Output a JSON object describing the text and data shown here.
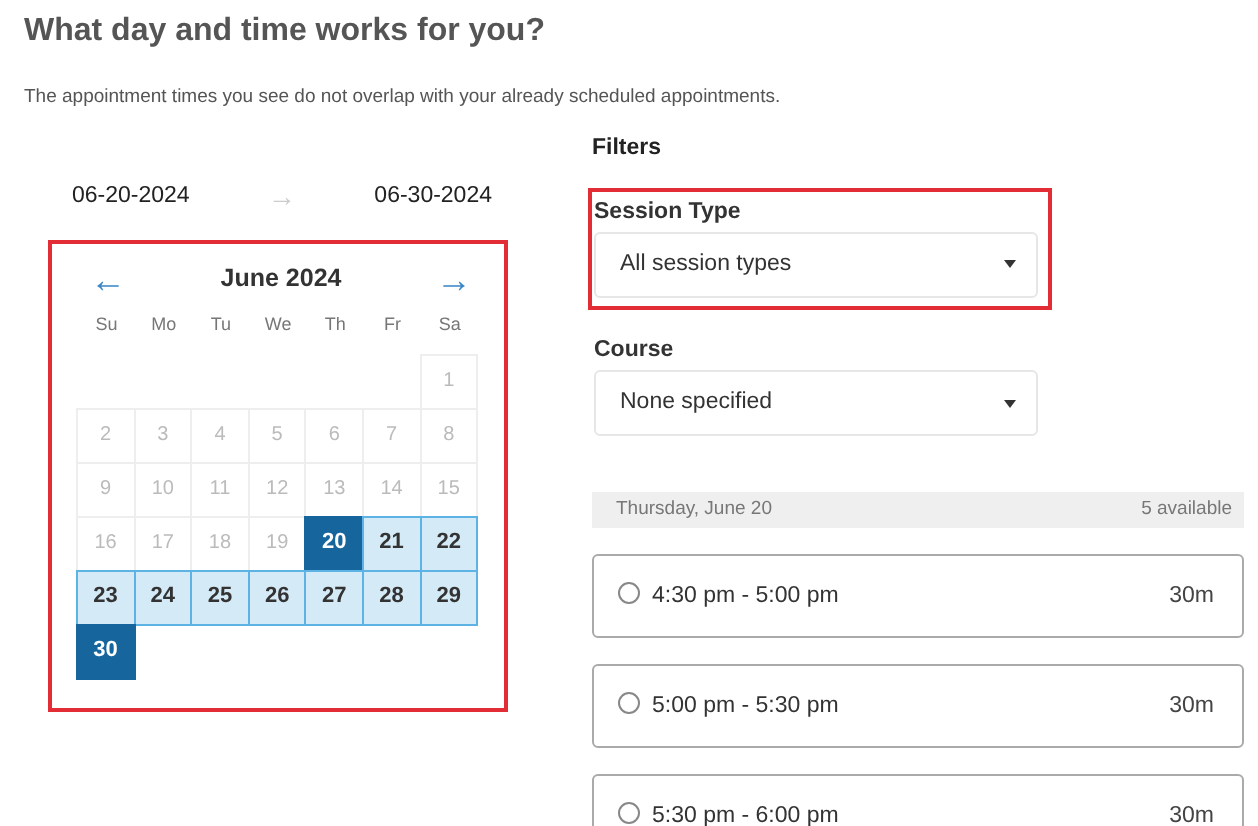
{
  "heading": "What day and time works for you?",
  "subtitle": "The appointment times you see do not overlap with your already scheduled appointments.",
  "date_range": {
    "start": "06-20-2024",
    "arrow": "→",
    "end": "06-30-2024"
  },
  "calendar": {
    "highlighted": true,
    "prev": "←",
    "month": "June 2024",
    "next": "→",
    "weekdays": [
      "Su",
      "Mo",
      "Tu",
      "We",
      "Th",
      "Fr",
      "Sa"
    ],
    "weeks": [
      [
        {
          "day": "1",
          "disabled": true,
          "selected": false
        }
      ],
      [
        {
          "day": "2",
          "disabled": true,
          "selected": false
        },
        {
          "day": "3",
          "disabled": true,
          "selected": false
        },
        {
          "day": "4",
          "disabled": true,
          "selected": false
        },
        {
          "day": "5",
          "disabled": true,
          "selected": false
        },
        {
          "day": "6",
          "disabled": true,
          "selected": false
        },
        {
          "day": "7",
          "disabled": true,
          "selected": false
        },
        {
          "day": "8",
          "disabled": true,
          "selected": false
        }
      ],
      [
        {
          "day": "9",
          "disabled": true,
          "selected": false
        },
        {
          "day": "10",
          "disabled": true,
          "selected": false
        },
        {
          "day": "11",
          "disabled": true,
          "selected": false
        },
        {
          "day": "12",
          "disabled": true,
          "selected": false
        },
        {
          "day": "13",
          "disabled": true,
          "selected": false
        },
        {
          "day": "14",
          "disabled": true,
          "selected": false
        },
        {
          "day": "15",
          "disabled": true,
          "selected": false
        }
      ],
      [
        {
          "day": "16",
          "disabled": true,
          "selected": false
        },
        {
          "day": "17",
          "disabled": true,
          "selected": false
        },
        {
          "day": "18",
          "disabled": true,
          "selected": false
        },
        {
          "day": "19",
          "disabled": true,
          "selected": false
        },
        {
          "day": "20",
          "disabled": false,
          "selected": true
        },
        {
          "day": "21",
          "disabled": false,
          "selected": false
        },
        {
          "day": "22",
          "disabled": false,
          "selected": false
        }
      ],
      [
        {
          "day": "23",
          "disabled": false,
          "selected": false
        },
        {
          "day": "24",
          "disabled": false,
          "selected": false
        },
        {
          "day": "25",
          "disabled": false,
          "selected": false
        },
        {
          "day": "26",
          "disabled": false,
          "selected": false
        },
        {
          "day": "27",
          "disabled": false,
          "selected": false
        },
        {
          "day": "28",
          "disabled": false,
          "selected": false
        },
        {
          "day": "29",
          "disabled": false,
          "selected": false
        }
      ],
      [
        {
          "day": "30",
          "disabled": false,
          "selected": true
        }
      ]
    ]
  },
  "filters": {
    "title": "Filters",
    "fields": [
      {
        "label": "Session Type",
        "value": "All session types",
        "highlighted": true
      },
      {
        "label": "Course",
        "value": "None specified",
        "highlighted": false
      }
    ]
  },
  "day_header": {
    "date": "Thursday, June 20",
    "count": "5 available"
  },
  "slots": [
    {
      "time": "4:30 pm - 5:00 pm",
      "duration": "30m",
      "selected": false
    },
    {
      "time": "5:00 pm - 5:30 pm",
      "duration": "30m",
      "selected": false
    },
    {
      "time": "5:30 pm - 6:00 pm",
      "duration": "30m",
      "selected": false
    }
  ]
}
